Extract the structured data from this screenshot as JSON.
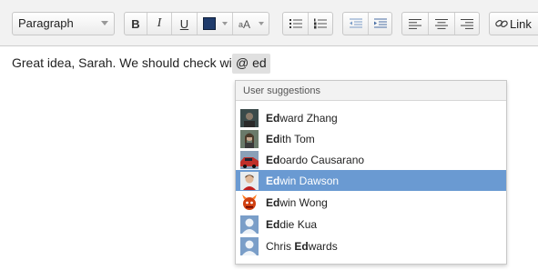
{
  "toolbar": {
    "paragraph_select": "Paragraph",
    "bold": "B",
    "italic": "I",
    "underline": "U",
    "text_color": "#1f3b6b",
    "link_label": "Link"
  },
  "editor": {
    "text": "Great idea, Sarah. We should check with",
    "mention_at": "@",
    "mention_query": "ed"
  },
  "suggestions": {
    "header": "User suggestions",
    "selected_index": 3,
    "items": [
      {
        "match": "Ed",
        "rest": "ward Zhang",
        "prefix": "",
        "avatar": "photo-dark"
      },
      {
        "match": "Ed",
        "rest": "ith Tom",
        "prefix": "",
        "avatar": "photo-woman"
      },
      {
        "match": "Ed",
        "rest": "oardo Causarano",
        "prefix": "",
        "avatar": "photo-car"
      },
      {
        "match": "Ed",
        "rest": "win Dawson",
        "prefix": "",
        "avatar": "photo-man"
      },
      {
        "match": "Ed",
        "rest": "win Wong",
        "prefix": "",
        "avatar": "monster-icon"
      },
      {
        "match": "Ed",
        "rest": "die Kua",
        "prefix": "",
        "avatar": "default-user-icon"
      },
      {
        "match": "Ed",
        "rest": "wards",
        "prefix": "Chris ",
        "avatar": "default-user-icon"
      }
    ]
  },
  "colors": {
    "selected_row": "#6a9ad2",
    "toolbar_bg": "#f2f2f2"
  }
}
